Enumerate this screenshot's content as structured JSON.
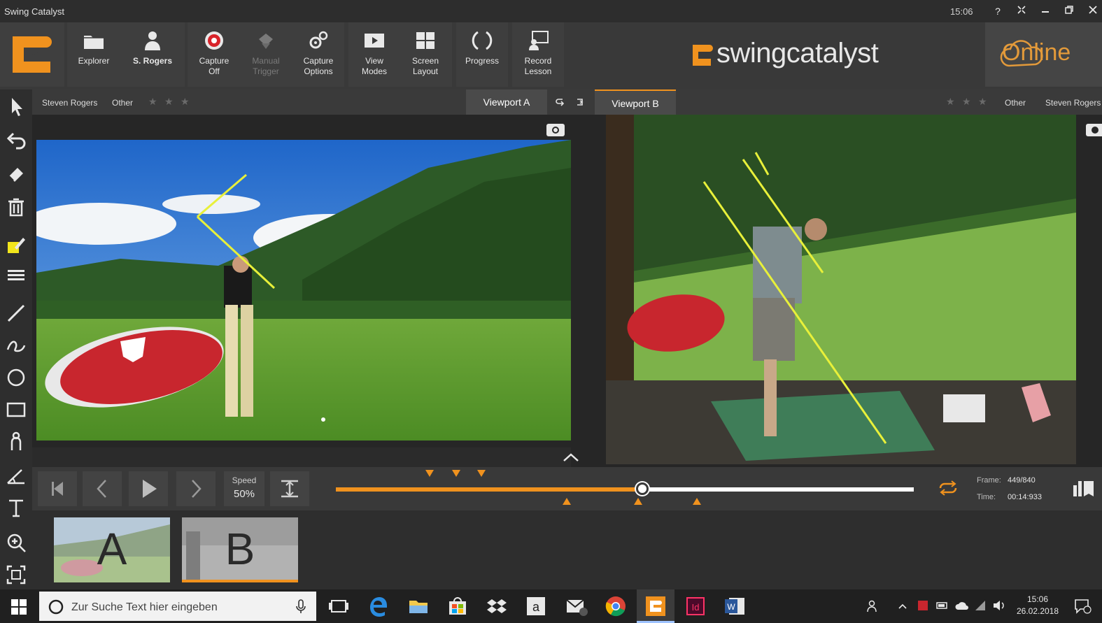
{
  "window": {
    "title": "Swing Catalyst",
    "clock": "15:06",
    "controls": [
      "help-icon",
      "fullscreen-icon",
      "minimize-icon",
      "restore-icon",
      "close-icon"
    ]
  },
  "toolbar": {
    "explorer": "Explorer",
    "user": "S. Rogers",
    "capture_line1": "Capture",
    "capture_line2": "Off",
    "manual_line1": "Manual",
    "manual_line2": "Trigger",
    "capture_opts_line1": "Capture",
    "capture_opts_line2": "Options",
    "view_line1": "View",
    "view_line2": "Modes",
    "screen_line1": "Screen",
    "screen_line2": "Layout",
    "progress": "Progress",
    "record_line1": "Record",
    "record_line2": "Lesson",
    "brand": "swingcatalyst",
    "online": "Online"
  },
  "viewport_a": {
    "player": "Steven Rogers",
    "category": "Other",
    "tab": "Viewport A",
    "rating": 0
  },
  "viewport_b": {
    "player": "Steven Rogers",
    "category": "Other",
    "tab": "Viewport B",
    "rating": 0
  },
  "transport": {
    "speed_label": "Speed",
    "speed_value": "50%",
    "progress": 0.53,
    "frame_label": "Frame:",
    "frame_value": "449/840",
    "time_label": "Time:",
    "time_value": "00:14:933"
  },
  "thumbnails": [
    "A",
    "B"
  ],
  "taskbar": {
    "search_placeholder": "Zur Suche Text hier eingeben",
    "time": "15:06",
    "date": "26.02.2018"
  },
  "colors": {
    "accent": "#f0921e",
    "annotation": "#e8f03a"
  }
}
